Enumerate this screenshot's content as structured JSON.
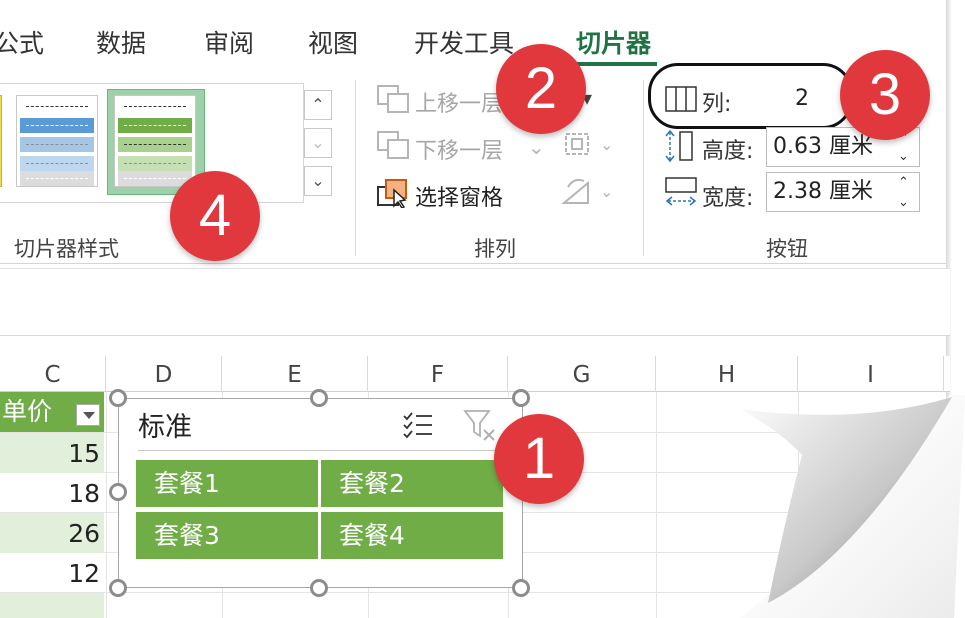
{
  "ribbon_tabs": [
    {
      "label": "公式",
      "active": false
    },
    {
      "label": "数据",
      "active": false
    },
    {
      "label": "审阅",
      "active": false
    },
    {
      "label": "视图",
      "active": false
    },
    {
      "label": "开发工具",
      "active": false
    },
    {
      "label": "切片器",
      "active": true
    }
  ],
  "groups": {
    "slicer_styles": {
      "label": "切片器样式"
    },
    "arrange": {
      "label": "排列",
      "bring_forward": "上移一层",
      "send_backward": "下移一层",
      "selection_pane": "选择窗格"
    },
    "buttons": {
      "label": "按钮",
      "columns_label": "列:",
      "columns_value": "2",
      "height_label": "高度:",
      "height_value": "0.63 厘米",
      "width_label": "宽度:",
      "width_value": "2.38 厘米"
    }
  },
  "columns": [
    "C",
    "D",
    "E",
    "F",
    "G",
    "H",
    "I"
  ],
  "table": {
    "header": "单价",
    "values": [
      "15",
      "18",
      "26",
      "12"
    ]
  },
  "slicer": {
    "title": "标准",
    "items": [
      "套餐1",
      "套餐2",
      "套餐3",
      "套餐4"
    ]
  },
  "badges": [
    "1",
    "2",
    "3",
    "4"
  ],
  "colors": {
    "accent": "#217346",
    "slicer_item": "#70ad47",
    "badge": "#e0383c",
    "table_band": "#e2efda"
  },
  "icons": [
    "multi-select-icon",
    "clear-filter-icon",
    "columns-icon",
    "height-icon",
    "width-icon",
    "selection-pane-icon"
  ]
}
